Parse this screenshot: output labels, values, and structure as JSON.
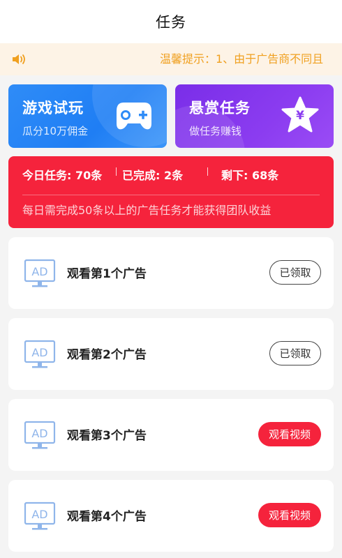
{
  "header": {
    "title": "任务"
  },
  "notice": {
    "icon": "speaker-icon",
    "text": "温馨提示：1、由于广告商不同且"
  },
  "cards": {
    "game": {
      "title": "游戏试玩",
      "subtitle": "瓜分10万佣金",
      "icon": "gamepad-icon"
    },
    "reward": {
      "title": "悬赏任务",
      "subtitle": "做任务赚钱",
      "icon": "yen-star-icon"
    }
  },
  "stats": {
    "today": "今日任务: 70条",
    "completed": "已完成: 2条",
    "remaining": "剩下: 68条",
    "note": "每日需完成50条以上的广告任务才能获得团队收益"
  },
  "tasks": [
    {
      "label": "观看第1个广告",
      "button": "已领取",
      "status": "claimed"
    },
    {
      "label": "观看第2个广告",
      "button": "已领取",
      "status": "claimed"
    },
    {
      "label": "观看第3个广告",
      "button": "观看视频",
      "status": "watch"
    },
    {
      "label": "观看第4个广告",
      "button": "观看视频",
      "status": "watch"
    }
  ],
  "colors": {
    "accent_red": "#f5233c",
    "notice_text": "#f0a020",
    "ad_icon": "#8fb5ea"
  }
}
